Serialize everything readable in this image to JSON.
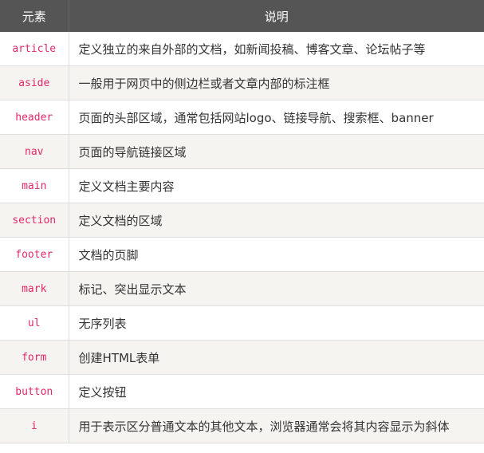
{
  "header": {
    "col_element": "元素",
    "col_desc": "说明"
  },
  "rows": [
    {
      "element": "article",
      "desc": "定义独立的来自外部的文档，如新闻投稿、博客文章、论坛帖子等"
    },
    {
      "element": "aside",
      "desc": "一般用于网页中的侧边栏或者文章内部的标注框"
    },
    {
      "element": "header",
      "desc": "页面的头部区域，通常包括网站logo、链接导航、搜索框、banner"
    },
    {
      "element": "nav",
      "desc": "页面的导航链接区域"
    },
    {
      "element": "main",
      "desc": "定义文档主要内容"
    },
    {
      "element": "section",
      "desc": "定义文档的区域"
    },
    {
      "element": "footer",
      "desc": "文档的页脚"
    },
    {
      "element": "mark",
      "desc": "标记、突出显示文本"
    },
    {
      "element": "ul",
      "desc": "无序列表"
    },
    {
      "element": "form",
      "desc": "创建HTML表单"
    },
    {
      "element": "button",
      "desc": "定义按钮"
    },
    {
      "element": "i",
      "desc": "用于表示区分普通文本的其他文本，浏览器通常会将其内容显示为斜体"
    }
  ],
  "colors": {
    "header_bg": "#555555",
    "element_text": "#e0286a",
    "stripe_bg": "#f6f4f0"
  }
}
